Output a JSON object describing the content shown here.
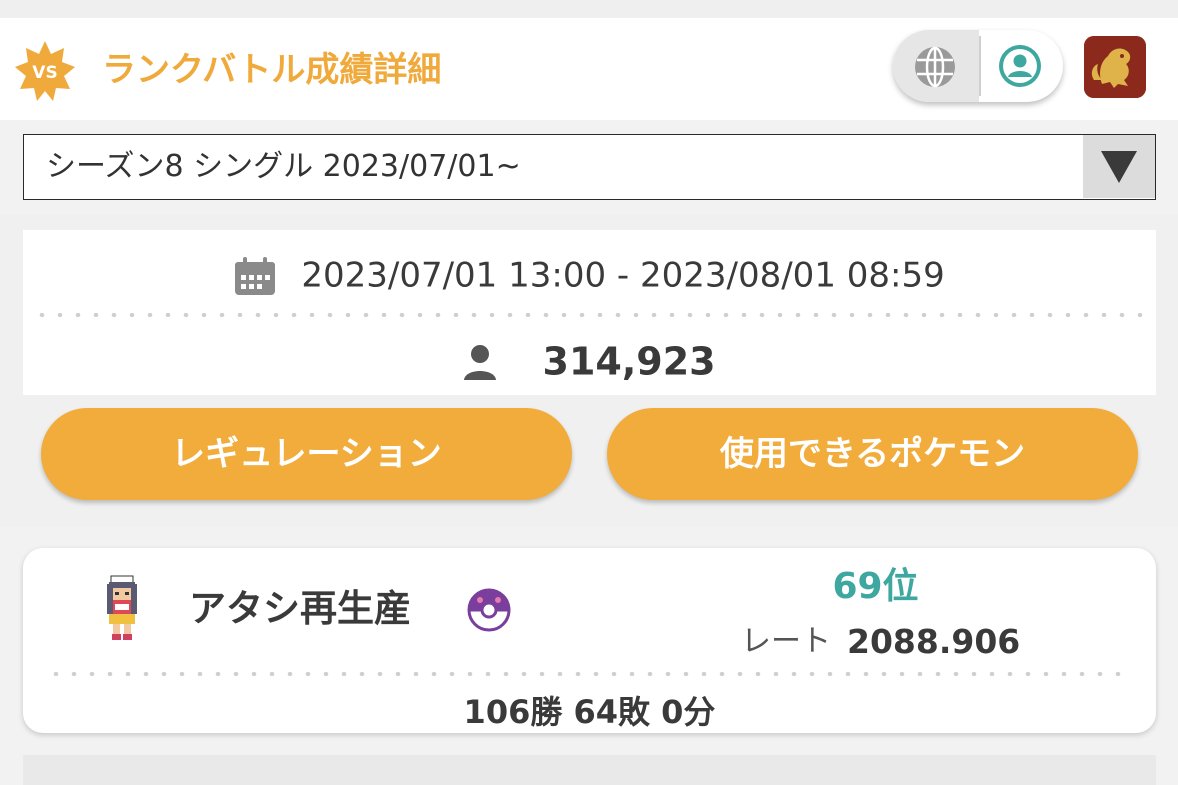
{
  "header": {
    "badge_text": "VS",
    "title": "ランクバトル成績詳細",
    "toggle_left_icon": "globe-icon",
    "toggle_right_icon": "user-circle-icon",
    "accent_color": "#f0a93b",
    "toggle_active_color": "#3ea7a0"
  },
  "season_select": {
    "value": "シーズン8 シングル 2023/07/01~"
  },
  "season_info": {
    "period": "2023/07/01 13:00 - 2023/08/01 08:59",
    "participants": "314,923"
  },
  "buttons": {
    "regulation": "レギュレーション",
    "usable_pokemon": "使用できるポケモン"
  },
  "result": {
    "trainer_name": "アタシ再生産",
    "rank": "69位",
    "rate_label": "レート",
    "rate_value": "2088.906",
    "record": "106勝 64敗 0分"
  }
}
